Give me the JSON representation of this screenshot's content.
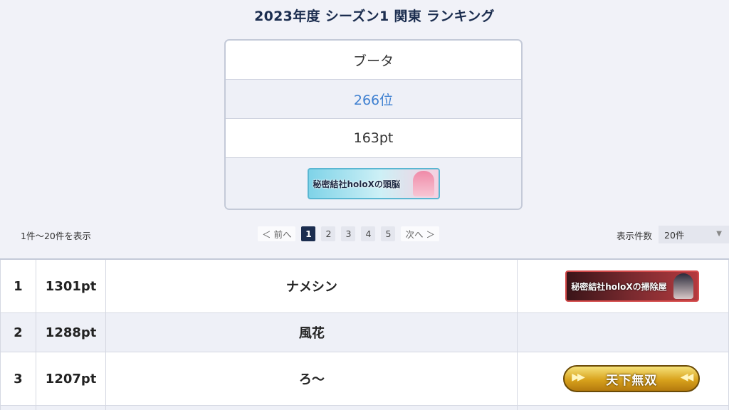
{
  "header": {
    "title": "2023年度 シーズン1 関東 ランキング"
  },
  "profile": {
    "name": "ブータ",
    "rank": "266位",
    "points": "163pt",
    "badge_text": "秘密結社holoXの頭脳"
  },
  "list_controls": {
    "count_text": "1件〜20件を表示",
    "prev_label": "＜ 前へ",
    "next_label": "次へ ＞",
    "pages": [
      "1",
      "2",
      "3",
      "4",
      "5"
    ],
    "current_page": "1",
    "per_page_label": "表示件数",
    "per_page_value": "20件"
  },
  "ranking": [
    {
      "rank": "1",
      "points": "1301pt",
      "name": "ナメシン",
      "badge_text": "秘密結社holoXの掃除屋"
    },
    {
      "rank": "2",
      "points": "1288pt",
      "name": "風花",
      "badge_text": ""
    },
    {
      "rank": "3",
      "points": "1207pt",
      "name": "ろ〜",
      "badge_text": "天下無双"
    }
  ],
  "colors": {
    "title": "#1b2d4f",
    "rank_highlight": "#3d7fd0",
    "active_page": "#1b2d4f",
    "row_alt": "#eef0f7"
  }
}
